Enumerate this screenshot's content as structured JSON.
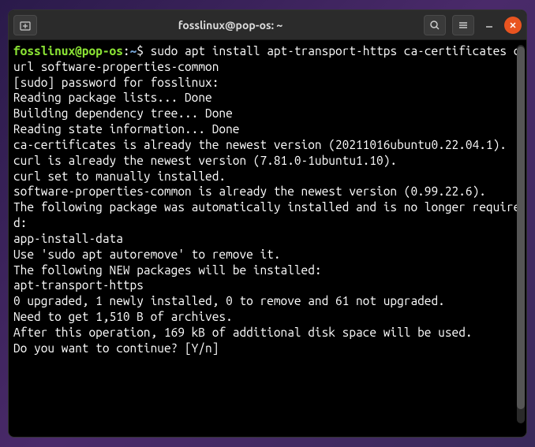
{
  "titlebar": {
    "title": "fosslinux@pop-os: ~"
  },
  "terminal": {
    "prompt_user_host": "fosslinux@pop-os",
    "prompt_sep1": ":",
    "prompt_path": "~",
    "prompt_dollar": "$ ",
    "command": "sudo apt install apt-transport-https ca-certificates curl software-properties-common",
    "lines": [
      "[sudo] password for fosslinux:",
      "Reading package lists... Done",
      "Building dependency tree... Done",
      "Reading state information... Done",
      "ca-certificates is already the newest version (20211016ubuntu0.22.04.1).",
      "curl is already the newest version (7.81.0-1ubuntu1.10).",
      "curl set to manually installed.",
      "software-properties-common is already the newest version (0.99.22.6).",
      "The following package was automatically installed and is no longer required:",
      "  app-install-data",
      "Use 'sudo apt autoremove' to remove it.",
      "The following NEW packages will be installed:",
      "  apt-transport-https",
      "0 upgraded, 1 newly installed, 0 to remove and 61 not upgraded.",
      "Need to get 1,510 B of archives.",
      "After this operation, 169 kB of additional disk space will be used.",
      "Do you want to continue? [Y/n]"
    ]
  }
}
